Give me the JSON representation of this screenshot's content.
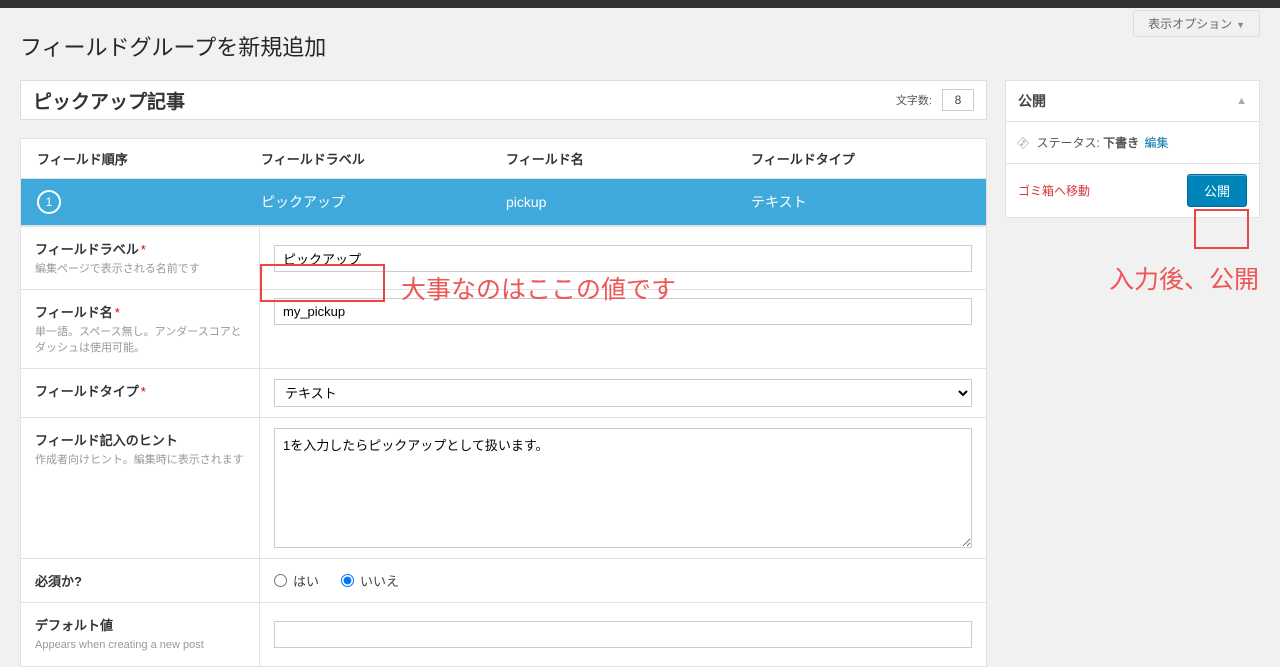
{
  "topbar": {},
  "screen_options": {
    "label": "表示オプション"
  },
  "page_title": "フィールドグループを新規追加",
  "title_input": {
    "value": "ピックアップ記事",
    "charcount_label": "文字数:",
    "charcount_value": "8"
  },
  "fields_header": {
    "order": "フィールド順序",
    "label": "フィールドラベル",
    "name": "フィールド名",
    "type": "フィールドタイプ"
  },
  "fields_row": {
    "order": "1",
    "label": "ピックアップ",
    "name": "pickup",
    "type": "テキスト"
  },
  "settings": {
    "field_label": {
      "lbl": "フィールドラベル",
      "sub": "編集ページで表示される名前です",
      "value": "ピックアップ"
    },
    "field_name": {
      "lbl": "フィールド名",
      "sub": "単一語。スペース無し。アンダースコアとダッシュは使用可能。",
      "value": "my_pickup"
    },
    "field_type": {
      "lbl": "フィールドタイプ",
      "value": "テキスト"
    },
    "field_hint": {
      "lbl": "フィールド記入のヒント",
      "sub": "作成者向けヒント。編集時に表示されます",
      "value": "1を入力したらピックアップとして扱います。"
    },
    "required": {
      "lbl": "必須か?",
      "yes": "はい",
      "no": "いいえ"
    },
    "default": {
      "lbl": "デフォルト値",
      "sub": "Appears when creating a new post"
    }
  },
  "publish": {
    "title": "公開",
    "status_label": "ステータス:",
    "status_value": "下書き",
    "edit": "編集",
    "trash": "ゴミ箱へ移動",
    "button": "公開"
  },
  "annotations": {
    "important_text": "大事なのはここの値です",
    "after_publish": "入力後、公開"
  }
}
